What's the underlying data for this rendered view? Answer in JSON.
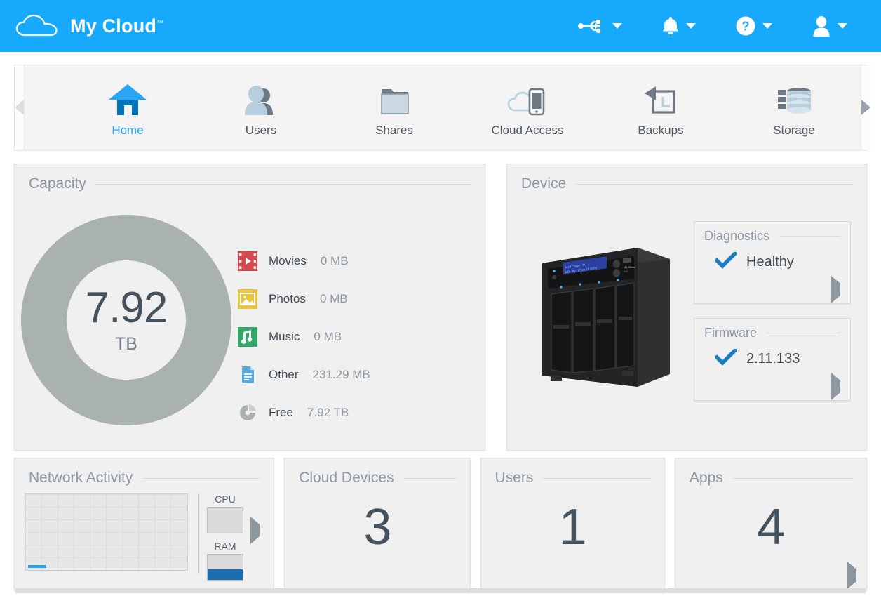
{
  "header": {
    "brand": "My Cloud",
    "trademark": "™",
    "logo_icon": "cloud-icon",
    "tools": [
      {
        "name": "usb-icon",
        "label": "USB",
        "caret": "chevron-down-icon"
      },
      {
        "name": "bell-icon",
        "label": "Notifications",
        "caret": "chevron-down-icon"
      },
      {
        "name": "help-icon",
        "label": "Help",
        "caret": "chevron-down-icon"
      },
      {
        "name": "user-icon",
        "label": "Account",
        "caret": "chevron-down-icon"
      }
    ],
    "accent_color": "#16a9fc"
  },
  "nav": {
    "prev_arrow": "chevron-left-icon",
    "next_arrow": "chevron-right-icon",
    "items": [
      {
        "label": "Home",
        "icon": "home-icon",
        "active": true
      },
      {
        "label": "Users",
        "icon": "users-icon",
        "active": false
      },
      {
        "label": "Shares",
        "icon": "folder-icon",
        "active": false
      },
      {
        "label": "Cloud Access",
        "icon": "cloud-phone-icon",
        "active": false
      },
      {
        "label": "Backups",
        "icon": "backup-icon",
        "active": false
      },
      {
        "label": "Storage",
        "icon": "storage-icon",
        "active": false
      }
    ]
  },
  "capacity": {
    "title": "Capacity",
    "total_value": "7.92",
    "total_unit": "TB",
    "legend": [
      {
        "label": "Movies",
        "value": "0 MB",
        "icon": "movies-icon",
        "color": "#d4494e"
      },
      {
        "label": "Photos",
        "value": "0 MB",
        "icon": "photos-icon",
        "color": "#ecc53c"
      },
      {
        "label": "Music",
        "value": "0 MB",
        "icon": "music-icon",
        "color": "#2fa765"
      },
      {
        "label": "Other",
        "value": "231.29 MB",
        "icon": "other-icon",
        "color": "#59a8dd"
      },
      {
        "label": "Free",
        "value": "7.92 TB",
        "icon": "free-icon",
        "color": "#a9b1b1"
      }
    ]
  },
  "device": {
    "title": "Device",
    "nas_image_alt": "nas-device",
    "lcd_line1": "Welcome to",
    "lcd_line2": "WD My Cloud EX4",
    "diagnostics": {
      "title": "Diagnostics",
      "status": "Healthy",
      "status_icon": "check-icon",
      "arrow": "chevron-right-icon"
    },
    "firmware": {
      "title": "Firmware",
      "version": "2.11.133",
      "status_icon": "check-icon",
      "arrow": "chevron-right-icon"
    }
  },
  "widgets": {
    "network": {
      "title": "Network Activity",
      "graph_icon": "line-graph",
      "cpu_label": "CPU",
      "cpu_percent": 0,
      "ram_label": "RAM",
      "ram_percent": 42,
      "arrow": "chevron-right-icon"
    },
    "cloud_devices": {
      "title": "Cloud Devices",
      "count": "3",
      "action_icon": "plus-circle-icon"
    },
    "users": {
      "title": "Users",
      "count": "1",
      "action_icon": "plus-circle-icon"
    },
    "apps": {
      "title": "Apps",
      "count": "4",
      "action_icon": "chevron-right-icon"
    }
  }
}
